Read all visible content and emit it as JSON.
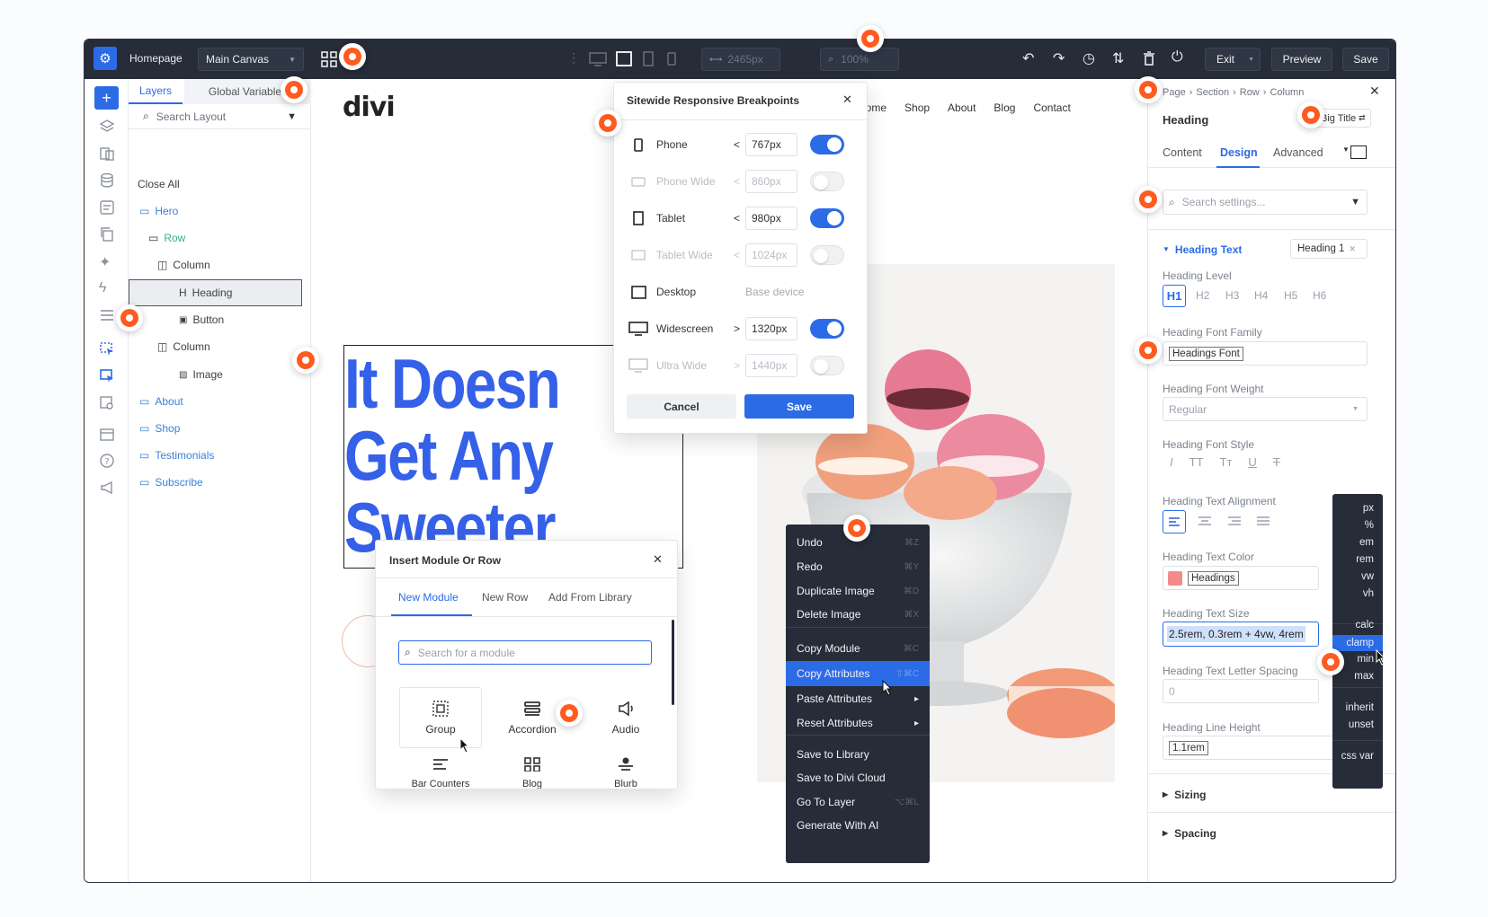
{
  "topbar": {
    "page": "Homepage",
    "canvas_select": "Main Canvas",
    "width_value": "2465px",
    "zoom_value": "100%",
    "exit_label": "Exit",
    "preview_label": "Preview",
    "save_label": "Save"
  },
  "layers": {
    "tab_layers": "Layers",
    "tab_global": "Global Variables",
    "search_placeholder": "Search Layout",
    "close_all": "Close All",
    "items": [
      {
        "label": "Hero",
        "kind": "section"
      },
      {
        "label": "Row",
        "kind": "row"
      },
      {
        "label": "Column",
        "kind": "column"
      },
      {
        "label": "Heading",
        "kind": "module",
        "selected": true
      },
      {
        "label": "Button",
        "kind": "module"
      },
      {
        "label": "Column",
        "kind": "column"
      },
      {
        "label": "Image",
        "kind": "module"
      },
      {
        "label": "About",
        "kind": "section"
      },
      {
        "label": "Shop",
        "kind": "section"
      },
      {
        "label": "Testimonials",
        "kind": "section"
      },
      {
        "label": "Subscribe",
        "kind": "section"
      }
    ]
  },
  "site": {
    "logo": "divi",
    "nav": [
      "Home",
      "Shop",
      "About",
      "Blog",
      "Contact"
    ],
    "hero_lines": [
      "It Doesn",
      "Get Any",
      "Sweeter"
    ]
  },
  "breakpoints": {
    "title": "Sitewide Responsive Breakpoints",
    "rows": [
      {
        "name": "Phone",
        "op": "<",
        "value": "767px",
        "enabled": true
      },
      {
        "name": "Phone Wide",
        "op": "<",
        "value": "860px",
        "enabled": false
      },
      {
        "name": "Tablet",
        "op": "<",
        "value": "980px",
        "enabled": true
      },
      {
        "name": "Tablet Wide",
        "op": "<",
        "value": "1024px",
        "enabled": false
      },
      {
        "name": "Desktop",
        "op": "",
        "value": "Base device",
        "enabled": null
      },
      {
        "name": "Widescreen",
        "op": ">",
        "value": "1320px",
        "enabled": true
      },
      {
        "name": "Ultra Wide",
        "op": ">",
        "value": "1440px",
        "enabled": false
      }
    ],
    "cancel": "Cancel",
    "save": "Save"
  },
  "insert": {
    "title": "Insert Module Or Row",
    "tabs": [
      "New Module",
      "New Row",
      "Add From Library"
    ],
    "search_placeholder": "Search for a module",
    "modules": [
      "Group",
      "Accordion",
      "Audio"
    ],
    "modules_partial": [
      "Bar Counters",
      "Blog",
      "Blurb"
    ]
  },
  "context_menu": {
    "items": [
      {
        "label": "Undo",
        "shortcut": "⌘Z"
      },
      {
        "label": "Redo",
        "shortcut": "⌘Y"
      },
      {
        "label": "Duplicate Image",
        "shortcut": "⌘D"
      },
      {
        "label": "Delete Image",
        "shortcut": "⌘X"
      },
      {
        "label": "Copy Module",
        "shortcut": "⌘C"
      },
      {
        "label": "Copy Attributes",
        "shortcut": "⇧⌘C"
      },
      {
        "label": "Paste Attributes",
        "shortcut": ""
      },
      {
        "label": "Reset Attributes",
        "shortcut": ""
      },
      {
        "label": "Save to Library",
        "shortcut": ""
      },
      {
        "label": "Save to Divi Cloud",
        "shortcut": ""
      },
      {
        "label": "Go To Layer",
        "shortcut": "⌥⌘L"
      },
      {
        "label": "Generate With AI",
        "shortcut": ""
      }
    ]
  },
  "settings": {
    "breadcrumb": [
      "Page",
      "Section",
      "Row",
      "Column"
    ],
    "module_title": "Heading",
    "preset": "Big Title",
    "tabs": [
      "Content",
      "Design",
      "Advanced"
    ],
    "search_placeholder": "Search settings...",
    "group_title": "Heading Text",
    "group_preset": "Heading 1",
    "heading_level_label": "Heading Level",
    "heading_levels": [
      "H1",
      "H2",
      "H3",
      "H4",
      "H5",
      "H6"
    ],
    "font_family_label": "Heading Font Family",
    "font_family_value": "Headings Font",
    "font_weight_label": "Heading Font Weight",
    "font_weight_value": "Regular",
    "font_style_label": "Heading Font Style",
    "alignment_label": "Heading Text Alignment",
    "color_label": "Heading Text Color",
    "color_value": "Headings",
    "size_label": "Heading Text Size",
    "size_value": "2.5rem, 0.3rem + 4vw, 4rem",
    "letter_spacing_label": "Heading Text Letter Spacing",
    "letter_spacing_value": "0",
    "line_height_label": "Heading Line Height",
    "line_height_value": "1.1rem",
    "sizing": "Sizing",
    "spacing": "Spacing"
  },
  "units": [
    "px",
    "%",
    "em",
    "rem",
    "vw",
    "vh",
    "calc",
    "clamp",
    "min",
    "max",
    "inherit",
    "unset",
    "css var"
  ],
  "colors": {
    "accent": "#2c6be6",
    "hero_text": "#3560e8",
    "topbar": "#262c38",
    "hotspot": "#ff5a1f",
    "swatch": "#f28b8b"
  }
}
